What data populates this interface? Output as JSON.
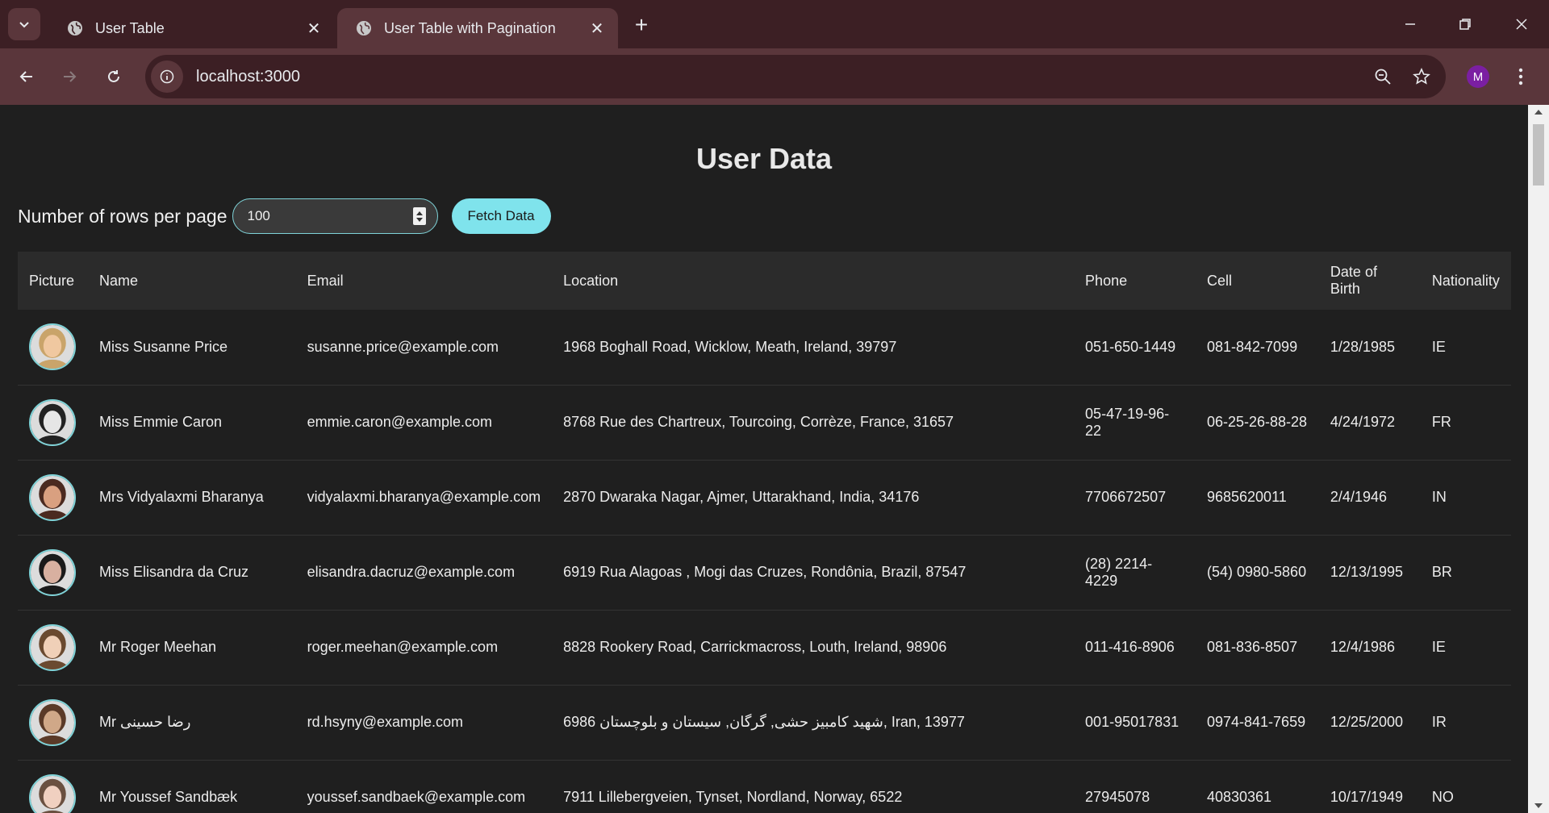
{
  "browser": {
    "tabs": [
      {
        "title": "User Table",
        "active": false
      },
      {
        "title": "User Table with Pagination",
        "active": true
      }
    ],
    "url": "localhost:3000",
    "profile_initial": "M"
  },
  "page": {
    "heading": "User Data",
    "rows_label": "Number of rows per page",
    "rows_value": "100",
    "fetch_label": "Fetch Data"
  },
  "table": {
    "headers": [
      "Picture",
      "Name",
      "Email",
      "Location",
      "Phone",
      "Cell",
      "Date of Birth",
      "Nationality"
    ],
    "rows": [
      {
        "name": "Miss Susanne Price",
        "email": "susanne.price@example.com",
        "location": "1968 Boghall Road, Wicklow, Meath, Ireland, 39797",
        "phone": "051-650-1449",
        "cell": "081-842-7099",
        "dob": "1/28/1985",
        "nat": "IE",
        "avatar_color": "#c9a46a",
        "avatar_skin": "#f0c8a0"
      },
      {
        "name": "Miss Emmie Caron",
        "email": "emmie.caron@example.com",
        "location": "8768 Rue des Chartreux, Tourcoing, Corrèze, France, 31657",
        "phone": "05-47-19-96-22",
        "cell": "06-25-26-88-28",
        "dob": "4/24/1972",
        "nat": "FR",
        "avatar_color": "#222222",
        "avatar_skin": "#e6e6e6"
      },
      {
        "name": "Mrs Vidyalaxmi Bharanya",
        "email": "vidyalaxmi.bharanya@example.com",
        "location": "2870 Dwaraka Nagar, Ajmer, Uttarakhand, India, 34176",
        "phone": "7706672507",
        "cell": "9685620011",
        "dob": "2/4/1946",
        "nat": "IN",
        "avatar_color": "#4a2a20",
        "avatar_skin": "#d9a080"
      },
      {
        "name": "Miss Elisandra da Cruz",
        "email": "elisandra.dacruz@example.com",
        "location": "6919 Rua Alagoas , Mogi das Cruzes, Rondônia, Brazil, 87547",
        "phone": "(28) 2214-4229",
        "cell": "(54) 0980-5860",
        "dob": "12/13/1995",
        "nat": "BR",
        "avatar_color": "#1a1a1a",
        "avatar_skin": "#d8b0a0"
      },
      {
        "name": "Mr Roger Meehan",
        "email": "roger.meehan@example.com",
        "location": "8828 Rookery Road, Carrickmacross, Louth, Ireland, 98906",
        "phone": "011-416-8906",
        "cell": "081-836-8507",
        "dob": "12/4/1986",
        "nat": "IE",
        "avatar_color": "#6a4a30",
        "avatar_skin": "#f0d0b8"
      },
      {
        "name": "Mr رضا حسینی",
        "email": "rd.hsyny@example.com",
        "location": "6986 شهید کامبیز حشی, گرگان, سیستان و بلوچستان, Iran, 13977",
        "phone": "001-95017831",
        "cell": "0974-841-7659",
        "dob": "12/25/2000",
        "nat": "IR",
        "avatar_color": "#5a3a28",
        "avatar_skin": "#d0a888"
      },
      {
        "name": "Mr Youssef Sandbæk",
        "email": "youssef.sandbaek@example.com",
        "location": "7911 Lillebergveien, Tynset, Nordland, Norway, 6522",
        "phone": "27945078",
        "cell": "40830361",
        "dob": "10/17/1949",
        "nat": "NO",
        "avatar_color": "#6a5040",
        "avatar_skin": "#f0d0c0"
      }
    ]
  }
}
